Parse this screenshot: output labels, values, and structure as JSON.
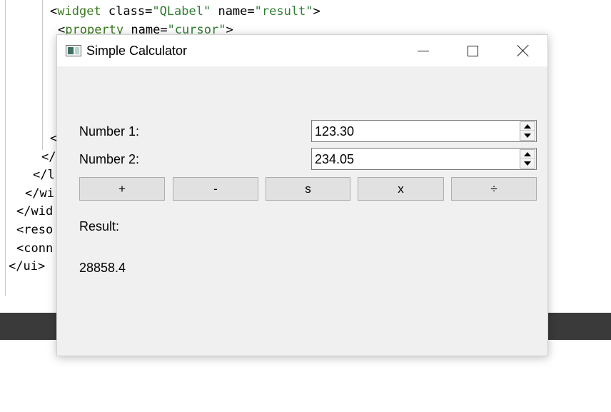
{
  "editor": {
    "lines": [
      {
        "tag_open": "<",
        "elem": "widget",
        "attr": " class=",
        "val": "\"QLabel\"",
        "attr2": " name=",
        "val2": "\"result\"",
        "close": ">"
      },
      {
        "tag_open": "<",
        "elem": "property",
        "attr": " name=",
        "val": "\"cursor\"",
        "close": ">"
      },
      {
        "text": "<"
      },
      {
        "text": "</"
      },
      {
        "text": "</l"
      },
      {
        "text": "</wi"
      },
      {
        "text": "</wid"
      },
      {
        "text": "<reso"
      },
      {
        "text": "<conn"
      },
      {
        "text": "</ui>"
      }
    ]
  },
  "window": {
    "title": "Simple Calculator",
    "controls": {
      "minimize": "minimize",
      "maximize": "maximize",
      "close": "close"
    }
  },
  "form": {
    "number1_label": "Number 1:",
    "number1_value": "123.30",
    "number2_label": "Number 2:",
    "number2_value": "234.05",
    "result_label": "Result:",
    "result_value": "28858.4"
  },
  "operations": [
    {
      "label": "+"
    },
    {
      "label": "-"
    },
    {
      "label": "s"
    },
    {
      "label": "x"
    },
    {
      "label": "÷"
    }
  ],
  "colors": {
    "window_bg": "#f0f0f0",
    "button_bg": "#e1e1e1",
    "taskbar": "#3a3a3a",
    "xml_green": "#2e7d32"
  }
}
